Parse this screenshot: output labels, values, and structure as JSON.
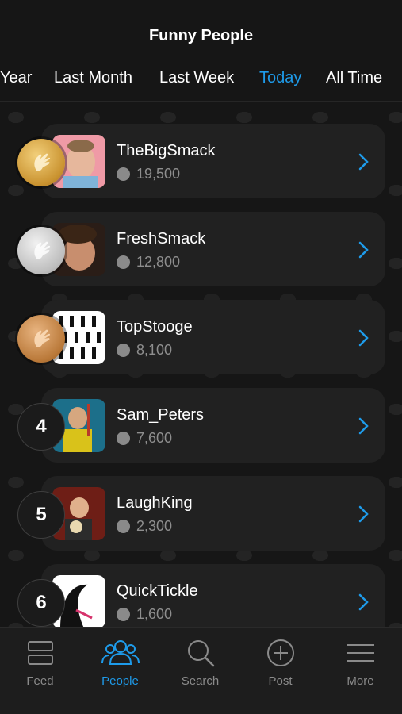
{
  "header": {
    "title": "Funny People",
    "tabs": [
      {
        "label": "Year"
      },
      {
        "label": "Last Month"
      },
      {
        "label": "Last Week"
      },
      {
        "label": "Today"
      },
      {
        "label": "All Time"
      }
    ],
    "active_tab": "Today"
  },
  "rankings": [
    {
      "rank": "1",
      "medal": "gold",
      "name": "TheBigSmack",
      "score": "19,500"
    },
    {
      "rank": "2",
      "medal": "silver",
      "name": "FreshSmack",
      "score": "12,800"
    },
    {
      "rank": "3",
      "medal": "bronze",
      "name": "TopStooge",
      "score": "8,100"
    },
    {
      "rank": "4",
      "medal": "",
      "name": "Sam_Peters",
      "score": "7,600"
    },
    {
      "rank": "5",
      "medal": "",
      "name": "LaughKing",
      "score": "2,300"
    },
    {
      "rank": "6",
      "medal": "",
      "name": "QuickTickle",
      "score": "1,600"
    }
  ],
  "tabbar": {
    "items": [
      {
        "label": "Feed",
        "icon": "feed-icon"
      },
      {
        "label": "People",
        "icon": "people-icon"
      },
      {
        "label": "Search",
        "icon": "search-icon"
      },
      {
        "label": "Post",
        "icon": "plus-circle-icon"
      },
      {
        "label": "More",
        "icon": "menu-icon"
      }
    ],
    "active": "People"
  },
  "colors": {
    "accent": "#1e9bea",
    "background": "#161616",
    "card": "#212121",
    "muted": "#8e8e8e"
  }
}
